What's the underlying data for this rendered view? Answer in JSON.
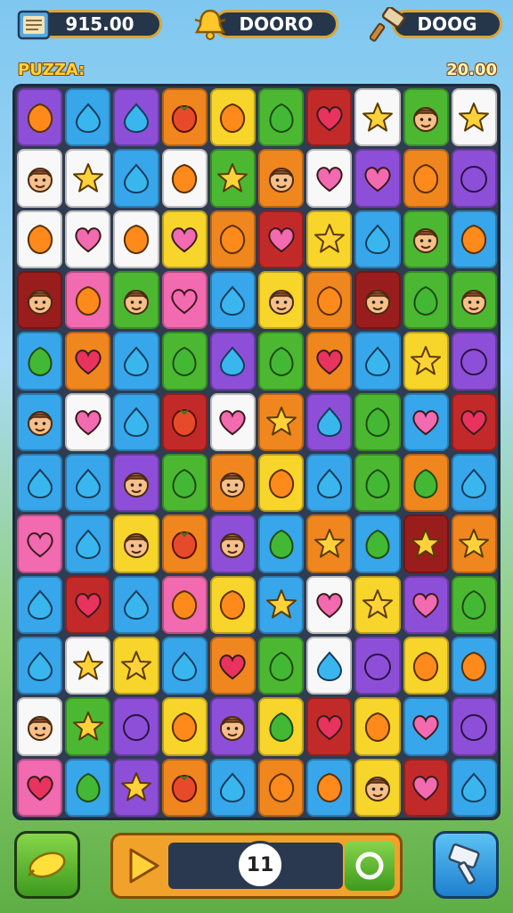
{
  "hud": {
    "coins": "915.00",
    "bell_value": "DOORO",
    "boost_value": "DOOG"
  },
  "level_label": "PUZZA:",
  "target_score": "20.00",
  "moves": "11",
  "palette": {
    "purple": "#8e4fd8",
    "blue": "#38a6ea",
    "orange": "#f0861e",
    "yellow": "#f7d52a",
    "green": "#4cb832",
    "red": "#c22a2a",
    "white": "#f8f8f8",
    "pink": "#f26ab0",
    "teal": "#38c8d8",
    "darkred": "#9a1d1d"
  },
  "gem_colors": {
    "heart": "#e8335f",
    "star": "#ffd23a",
    "drop": "#3ab6ef",
    "leaf": "#43b835",
    "gem": "#ff8a1c",
    "face": "#f7c08a",
    "plum": "#8e4fd8",
    "rose": "#f26ab0",
    "tomato": "#e74a2a"
  },
  "grid": [
    [
      [
        "purple",
        "gem"
      ],
      [
        "blue",
        "drop"
      ],
      [
        "purple",
        "drop"
      ],
      [
        "orange",
        "tomato"
      ],
      [
        "yellow",
        "gem"
      ],
      [
        "green",
        "leaf"
      ],
      [
        "red",
        "heart"
      ],
      [
        "white",
        "star"
      ],
      [
        "green",
        "face"
      ],
      [
        "white",
        "star"
      ]
    ],
    [
      [
        "white",
        "face"
      ],
      [
        "white",
        "star"
      ],
      [
        "blue",
        "drop"
      ],
      [
        "white",
        "gem"
      ],
      [
        "green",
        "star"
      ],
      [
        "orange",
        "face"
      ],
      [
        "white",
        "rose"
      ],
      [
        "purple",
        "rose"
      ],
      [
        "orange",
        "gem"
      ],
      [
        "purple",
        "plum"
      ]
    ],
    [
      [
        "white",
        "gem"
      ],
      [
        "white",
        "rose"
      ],
      [
        "white",
        "gem"
      ],
      [
        "yellow",
        "rose"
      ],
      [
        "orange",
        "gem"
      ],
      [
        "red",
        "rose"
      ],
      [
        "yellow",
        "star"
      ],
      [
        "blue",
        "drop"
      ],
      [
        "green",
        "face"
      ],
      [
        "blue",
        "gem"
      ]
    ],
    [
      [
        "darkred",
        "face"
      ],
      [
        "pink",
        "gem"
      ],
      [
        "green",
        "face"
      ],
      [
        "pink",
        "rose"
      ],
      [
        "blue",
        "drop"
      ],
      [
        "yellow",
        "face"
      ],
      [
        "orange",
        "gem"
      ],
      [
        "darkred",
        "face"
      ],
      [
        "green",
        "leaf"
      ],
      [
        "green",
        "face"
      ]
    ],
    [
      [
        "blue",
        "leaf"
      ],
      [
        "orange",
        "heart"
      ],
      [
        "blue",
        "drop"
      ],
      [
        "green",
        "leaf"
      ],
      [
        "purple",
        "drop"
      ],
      [
        "green",
        "leaf"
      ],
      [
        "orange",
        "heart"
      ],
      [
        "blue",
        "drop"
      ],
      [
        "yellow",
        "star"
      ],
      [
        "purple",
        "plum"
      ]
    ],
    [
      [
        "blue",
        "face"
      ],
      [
        "white",
        "rose"
      ],
      [
        "blue",
        "drop"
      ],
      [
        "red",
        "tomato"
      ],
      [
        "white",
        "rose"
      ],
      [
        "orange",
        "star"
      ],
      [
        "purple",
        "drop"
      ],
      [
        "green",
        "leaf"
      ],
      [
        "blue",
        "rose"
      ],
      [
        "red",
        "heart"
      ]
    ],
    [
      [
        "blue",
        "drop"
      ],
      [
        "blue",
        "drop"
      ],
      [
        "purple",
        "face"
      ],
      [
        "green",
        "leaf"
      ],
      [
        "orange",
        "face"
      ],
      [
        "yellow",
        "gem"
      ],
      [
        "blue",
        "drop"
      ],
      [
        "green",
        "leaf"
      ],
      [
        "orange",
        "leaf"
      ],
      [
        "blue",
        "drop"
      ]
    ],
    [
      [
        "pink",
        "rose"
      ],
      [
        "blue",
        "drop"
      ],
      [
        "yellow",
        "face"
      ],
      [
        "orange",
        "tomato"
      ],
      [
        "purple",
        "face"
      ],
      [
        "blue",
        "leaf"
      ],
      [
        "orange",
        "star"
      ],
      [
        "blue",
        "leaf"
      ],
      [
        "darkred",
        "star"
      ],
      [
        "orange",
        "star"
      ]
    ],
    [
      [
        "blue",
        "drop"
      ],
      [
        "red",
        "heart"
      ],
      [
        "blue",
        "drop"
      ],
      [
        "pink",
        "gem"
      ],
      [
        "yellow",
        "gem"
      ],
      [
        "blue",
        "star"
      ],
      [
        "white",
        "rose"
      ],
      [
        "yellow",
        "star"
      ],
      [
        "purple",
        "rose"
      ],
      [
        "green",
        "leaf"
      ]
    ],
    [
      [
        "blue",
        "drop"
      ],
      [
        "white",
        "star"
      ],
      [
        "yellow",
        "star"
      ],
      [
        "blue",
        "drop"
      ],
      [
        "orange",
        "heart"
      ],
      [
        "green",
        "leaf"
      ],
      [
        "white",
        "drop"
      ],
      [
        "purple",
        "plum"
      ],
      [
        "yellow",
        "gem"
      ],
      [
        "blue",
        "gem"
      ]
    ],
    [
      [
        "white",
        "face"
      ],
      [
        "green",
        "star"
      ],
      [
        "purple",
        "plum"
      ],
      [
        "yellow",
        "gem"
      ],
      [
        "purple",
        "face"
      ],
      [
        "yellow",
        "leaf"
      ],
      [
        "red",
        "heart"
      ],
      [
        "yellow",
        "gem"
      ],
      [
        "blue",
        "rose"
      ],
      [
        "purple",
        "plum"
      ]
    ],
    [
      [
        "pink",
        "heart"
      ],
      [
        "blue",
        "leaf"
      ],
      [
        "purple",
        "star"
      ],
      [
        "orange",
        "tomato"
      ],
      [
        "blue",
        "drop"
      ],
      [
        "orange",
        "gem"
      ],
      [
        "blue",
        "gem"
      ],
      [
        "yellow",
        "face"
      ],
      [
        "red",
        "rose"
      ],
      [
        "blue",
        "drop"
      ]
    ]
  ]
}
